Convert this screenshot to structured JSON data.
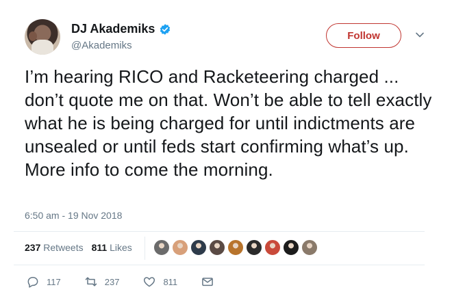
{
  "user": {
    "display_name": "DJ Akademiks",
    "handle": "@Akademiks",
    "verified": true
  },
  "follow_button": {
    "label": "Follow"
  },
  "tweet": {
    "text": "I’m hearing RICO and Racketeering charged ... don’t quote me on that. Won’t be able to tell exactly what he is being charged for until indictments are unsealed or until feds start confirming what’s up. More info to come the morning.",
    "timestamp": "6:50 am - 19 Nov 2018"
  },
  "stats": {
    "retweets_count": "237",
    "retweets_label": "Retweets",
    "likes_count": "811",
    "likes_label": "Likes"
  },
  "likers": [
    {
      "color": "#6b6b6b"
    },
    {
      "color": "#d8a07a"
    },
    {
      "color": "#2e3b4a"
    },
    {
      "color": "#5a4a44"
    },
    {
      "color": "#b8742c"
    },
    {
      "color": "#2b2b2b"
    },
    {
      "color": "#c94a3a"
    },
    {
      "color": "#1c1c1c"
    },
    {
      "color": "#8a7a6a"
    }
  ],
  "actions": {
    "replies": "117",
    "retweets": "237",
    "likes": "811"
  },
  "colors": {
    "accent": "#c0342f",
    "verified": "#1da1f2",
    "muted": "#657786"
  }
}
